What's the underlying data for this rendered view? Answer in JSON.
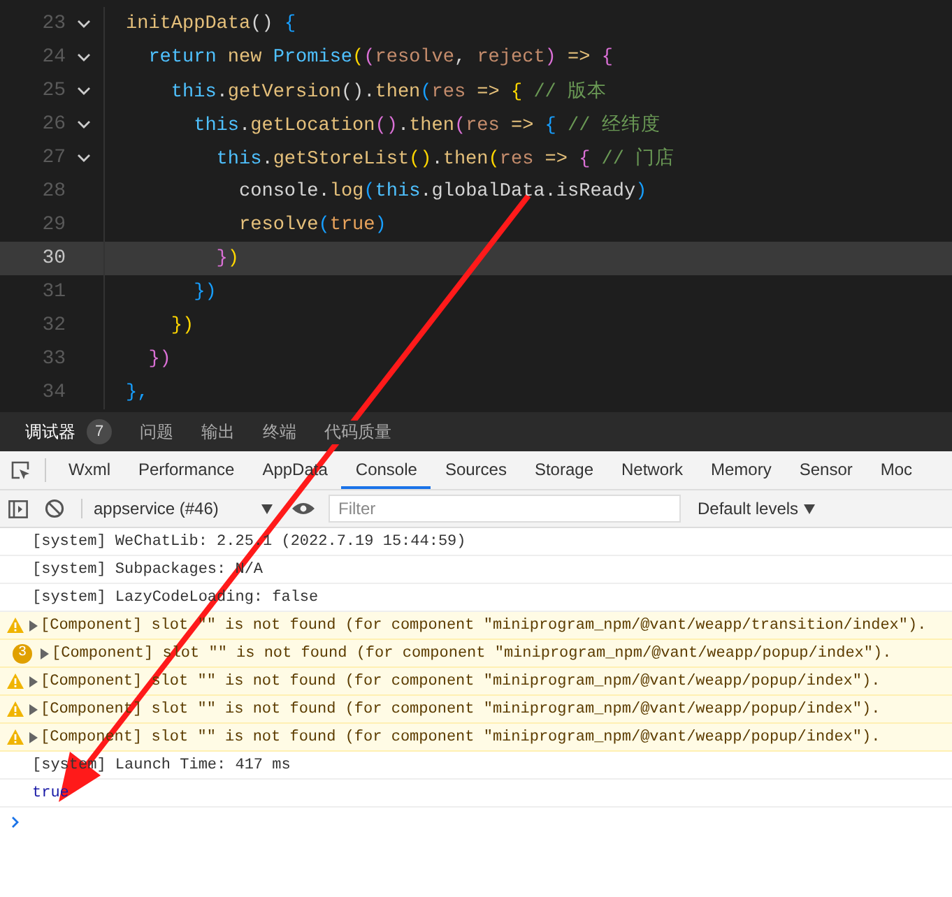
{
  "editor": {
    "lines": [
      {
        "number": "23",
        "foldable": true,
        "current": false,
        "tokens": [
          {
            "t": "initAppData",
            "kind": "func"
          },
          {
            "t": "() ",
            "kind": "plain"
          },
          {
            "t": "{",
            "kind": "b3"
          }
        ]
      },
      {
        "number": "24",
        "foldable": true,
        "current": false,
        "tokens": [
          {
            "t": "  return ",
            "kind": "kw"
          },
          {
            "t": "new ",
            "kind": "func"
          },
          {
            "t": "Promise",
            "kind": "kw"
          },
          {
            "t": "(",
            "kind": "b1"
          },
          {
            "t": "(",
            "kind": "b2"
          },
          {
            "t": "resolve",
            "kind": "param"
          },
          {
            "t": ", ",
            "kind": "plain"
          },
          {
            "t": "reject",
            "kind": "param"
          },
          {
            "t": ")",
            "kind": "b2"
          },
          {
            "t": " => ",
            "kind": "func"
          },
          {
            "t": "{",
            "kind": "b2"
          }
        ]
      },
      {
        "number": "25",
        "foldable": true,
        "current": false,
        "tokens": [
          {
            "t": "    this",
            "kind": "kw"
          },
          {
            "t": ".",
            "kind": "plain"
          },
          {
            "t": "getVersion",
            "kind": "func"
          },
          {
            "t": "()",
            "kind": "plain"
          },
          {
            "t": ".",
            "kind": "plain"
          },
          {
            "t": "then",
            "kind": "func"
          },
          {
            "t": "(",
            "kind": "b3"
          },
          {
            "t": "res",
            "kind": "param"
          },
          {
            "t": " => ",
            "kind": "func"
          },
          {
            "t": "{",
            "kind": "b1"
          },
          {
            "t": " // 版本",
            "kind": "comment"
          }
        ]
      },
      {
        "number": "26",
        "foldable": true,
        "current": false,
        "tokens": [
          {
            "t": "      this",
            "kind": "kw"
          },
          {
            "t": ".",
            "kind": "plain"
          },
          {
            "t": "getLocation",
            "kind": "func"
          },
          {
            "t": "()",
            "kind": "b2"
          },
          {
            "t": ".",
            "kind": "plain"
          },
          {
            "t": "then",
            "kind": "func"
          },
          {
            "t": "(",
            "kind": "b2"
          },
          {
            "t": "res",
            "kind": "param"
          },
          {
            "t": " => ",
            "kind": "func"
          },
          {
            "t": "{",
            "kind": "b3"
          },
          {
            "t": " // 经纬度",
            "kind": "comment"
          }
        ]
      },
      {
        "number": "27",
        "foldable": true,
        "current": false,
        "tokens": [
          {
            "t": "        this",
            "kind": "kw"
          },
          {
            "t": ".",
            "kind": "plain"
          },
          {
            "t": "getStoreList",
            "kind": "func"
          },
          {
            "t": "()",
            "kind": "b1"
          },
          {
            "t": ".",
            "kind": "plain"
          },
          {
            "t": "then",
            "kind": "func"
          },
          {
            "t": "(",
            "kind": "b1"
          },
          {
            "t": "res",
            "kind": "param"
          },
          {
            "t": " => ",
            "kind": "func"
          },
          {
            "t": "{",
            "kind": "b2"
          },
          {
            "t": " // 门店",
            "kind": "comment"
          }
        ]
      },
      {
        "number": "28",
        "foldable": false,
        "current": false,
        "tokens": [
          {
            "t": "          console",
            "kind": "plain"
          },
          {
            "t": ".",
            "kind": "plain"
          },
          {
            "t": "log",
            "kind": "func"
          },
          {
            "t": "(",
            "kind": "b3"
          },
          {
            "t": "this",
            "kind": "kw"
          },
          {
            "t": ".globalData.isReady",
            "kind": "plain"
          },
          {
            "t": ")",
            "kind": "b3"
          }
        ]
      },
      {
        "number": "29",
        "foldable": false,
        "current": false,
        "tokens": [
          {
            "t": "          resolve",
            "kind": "func"
          },
          {
            "t": "(",
            "kind": "b3"
          },
          {
            "t": "true",
            "kind": "bool"
          },
          {
            "t": ")",
            "kind": "b3"
          }
        ]
      },
      {
        "number": "30",
        "foldable": false,
        "current": true,
        "tokens": [
          {
            "t": "        }",
            "kind": "b2"
          },
          {
            "t": ")",
            "kind": "b1"
          }
        ]
      },
      {
        "number": "31",
        "foldable": false,
        "current": false,
        "tokens": [
          {
            "t": "      })",
            "kind": "b3"
          }
        ]
      },
      {
        "number": "32",
        "foldable": false,
        "current": false,
        "tokens": [
          {
            "t": "    })",
            "kind": "b1"
          }
        ]
      },
      {
        "number": "33",
        "foldable": false,
        "current": false,
        "tokens": [
          {
            "t": "  })",
            "kind": "b2"
          }
        ]
      },
      {
        "number": "34",
        "foldable": false,
        "current": false,
        "tokens": [
          {
            "t": "},",
            "kind": "b3"
          }
        ]
      }
    ]
  },
  "panel_tabs": [
    {
      "label": "调试器",
      "badge": "7",
      "selected": true
    },
    {
      "label": "问题",
      "selected": false
    },
    {
      "label": "输出",
      "selected": false
    },
    {
      "label": "终端",
      "selected": false
    },
    {
      "label": "代码质量",
      "selected": false
    }
  ],
  "devtools_tabs": [
    {
      "label": "Wxml",
      "selected": false
    },
    {
      "label": "Performance",
      "selected": false
    },
    {
      "label": "AppData",
      "selected": false
    },
    {
      "label": "Console",
      "selected": true
    },
    {
      "label": "Sources",
      "selected": false
    },
    {
      "label": "Storage",
      "selected": false
    },
    {
      "label": "Network",
      "selected": false
    },
    {
      "label": "Memory",
      "selected": false
    },
    {
      "label": "Sensor",
      "selected": false
    },
    {
      "label": "Moc",
      "selected": false
    }
  ],
  "toolbar": {
    "context": "appservice (#46)",
    "filter": {
      "placeholder": "Filter"
    },
    "levels": "Default levels"
  },
  "console": [
    {
      "kind": "log",
      "text": "[system] WeChatLib: 2.25.1 (2022.7.19 15:44:59)"
    },
    {
      "kind": "log",
      "text": "[system] Subpackages: N/A"
    },
    {
      "kind": "log",
      "text": "[system] LazyCodeLoading: false"
    },
    {
      "kind": "warning",
      "text": "[Component] slot \"\" is not found (for component \"miniprogram_npm/@vant/weapp/transition/index\")."
    },
    {
      "kind": "warning",
      "count": "3",
      "text": "[Component] slot \"\" is not found (for component \"miniprogram_npm/@vant/weapp/popup/index\")."
    },
    {
      "kind": "warning",
      "text": "[Component] slot \"\" is not found (for component \"miniprogram_npm/@vant/weapp/popup/index\")."
    },
    {
      "kind": "warning",
      "text": "[Component] slot \"\" is not found (for component \"miniprogram_npm/@vant/weapp/popup/index\")."
    },
    {
      "kind": "warning",
      "text": "[Component] slot \"\" is not found (for component \"miniprogram_npm/@vant/weapp/popup/index\")."
    },
    {
      "kind": "log",
      "text": "[system] Launch Time: 417 ms"
    },
    {
      "kind": "result",
      "text": "true"
    }
  ]
}
